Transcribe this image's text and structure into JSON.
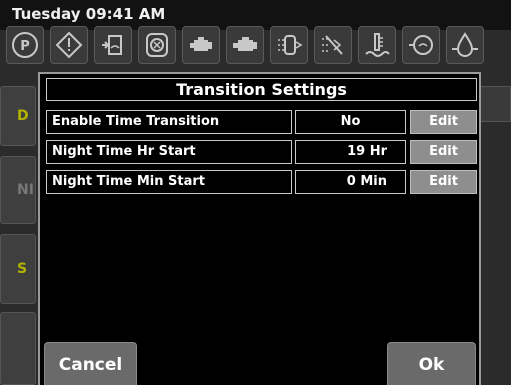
{
  "status": {
    "clock": "Tuesday 09:41 AM"
  },
  "indicators": [
    {
      "icon": "parking-brake-icon"
    },
    {
      "icon": "warning-icon"
    },
    {
      "icon": "coolant-level-icon"
    },
    {
      "icon": "air-filter-icon"
    },
    {
      "icon": "engine-icon"
    },
    {
      "icon": "engine-check-icon"
    },
    {
      "icon": "exhaust-filter-icon"
    },
    {
      "icon": "exhaust-filter-disabled-icon"
    },
    {
      "icon": "coolant-temp-icon"
    },
    {
      "icon": "transmission-temp-icon"
    },
    {
      "icon": "oil-pressure-icon"
    }
  ],
  "background": {
    "left_buttons": [
      {
        "label": "D",
        "color": "#b3b300"
      },
      {
        "label": "NI",
        "color": "#777777"
      },
      {
        "label": "S",
        "color": "#b3b300"
      },
      {
        "label": "",
        "color": "#777777"
      }
    ]
  },
  "dialog": {
    "title": "Transition Settings",
    "rows": [
      {
        "label": "Enable Time Transition",
        "value": "No",
        "edit": "Edit"
      },
      {
        "label": "Night Time Hr Start",
        "value": "19 Hr",
        "edit": "Edit"
      },
      {
        "label": "Night Time Min Start",
        "value": "0 Min",
        "edit": "Edit"
      }
    ],
    "cancel": "Cancel",
    "ok": "Ok"
  }
}
